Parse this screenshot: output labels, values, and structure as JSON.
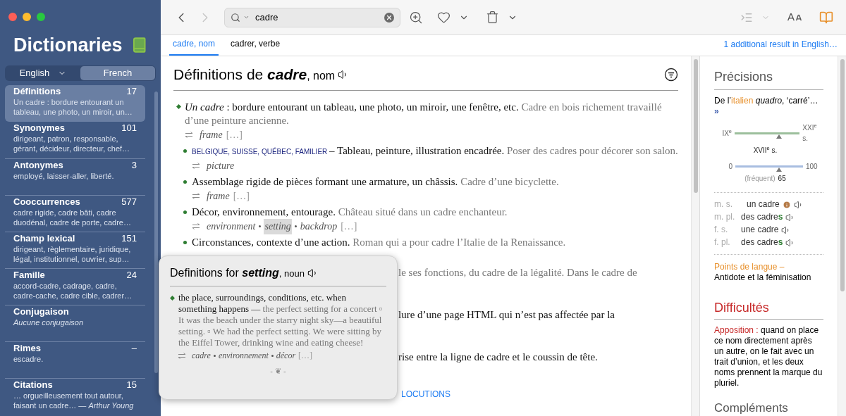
{
  "sidebar": {
    "title": "Dictionaries",
    "languages": [
      {
        "label": "English",
        "selected": false,
        "has_menu": true
      },
      {
        "label": "French",
        "selected": true,
        "has_menu": false
      }
    ],
    "items": [
      {
        "title": "Définitions",
        "count": "17",
        "preview": "Un cadre : bordure entourant un tableau, une photo, un miroir, un…",
        "selected": true
      },
      {
        "title": "Synonymes",
        "count": "101",
        "preview": "dirigeant, patron, responsable, gérant, décideur, directeur, chef…",
        "selected": false
      },
      {
        "title": "Antonymes",
        "count": "3",
        "preview": "employé, laisser-aller, liberté.",
        "selected": false
      },
      {
        "title": "Cooccurrences",
        "count": "577",
        "preview": "cadre rigide, cadre bâti, cadre duodénal, cadre de porte, cadre…",
        "selected": false
      },
      {
        "title": "Champ lexical",
        "count": "151",
        "preview": "dirigeant, règlementaire, juridique, légal, institutionnel, ouvrier, sup…",
        "selected": false
      },
      {
        "title": "Famille",
        "count": "24",
        "preview": "accord-cadre, cadrage, cadre, cadre-cache, cadre cible, cadrer…",
        "selected": false
      },
      {
        "title": "Conjugaison",
        "preview": "*Aucune conjugaison*",
        "selected": false
      },
      {
        "title": "Rimes",
        "count": "–",
        "preview": "escadre.",
        "selected": false
      },
      {
        "title": "Citations",
        "count": "15",
        "preview": "… orgueilleusement tout autour, faisant un cadre… — *Arthur Young*",
        "selected": false
      }
    ]
  },
  "toolbar": {
    "search": {
      "value": "cadre"
    },
    "forward_disabled": true
  },
  "tabs": [
    {
      "label": "cadre, nom",
      "selected": true
    },
    {
      "label": "cadrer, verbe",
      "selected": false
    }
  ],
  "extra_result": "1 additional result in English…",
  "article": {
    "prefix": "Définitions de",
    "word": "cadre",
    "suffix": ", nom",
    "entries": [
      {
        "kind": "main",
        "text": "*Un cadre* : bordure entourant un tableau, une photo, un miroir, une fenêtre, etc.",
        "example": "Cadre en bois richement travaillé d’une peinture ancienne.",
        "translations": [
          {
            "word": "frame",
            "selected": false
          }
        ],
        "more": "[…]"
      },
      {
        "kind": "sub",
        "labels": "BELGIQUE, SUISSE, QUÉBEC, FAMILIER",
        "dash": "–",
        "text": "Tableau, peinture, illustration encadrée.",
        "example": "Poser des cadres pour décorer son salon.",
        "translations": [
          {
            "word": "picture",
            "selected": false
          }
        ]
      },
      {
        "kind": "sub",
        "text": "Assemblage rigide de pièces formant une armature, un châssis.",
        "example": "Cadre d’une bicyclette.",
        "translations": [
          {
            "word": "frame",
            "selected": false
          }
        ],
        "more": "[…]"
      },
      {
        "kind": "sub",
        "text": "Décor, environnement, entourage.",
        "example": "Château situé dans un cadre enchanteur.",
        "translations": [
          {
            "word": "environment",
            "selected": false
          },
          {
            "word": "setting",
            "selected": true
          },
          {
            "word": "backdrop",
            "selected": false
          }
        ],
        "more": "[…]"
      },
      {
        "kind": "sub",
        "text": "Circonstances, contexte d’une action.",
        "example": "Roman qui a pour cadre l’Italie de la Renaissance."
      }
    ],
    "fragments": [
      {
        "kind": "example",
        "text": "le ses fonctions, du cadre de la légalité. Dans le cadre de"
      },
      {
        "kind": "definition",
        "text": "lure d’une page HTML qui n’est pas affectée par la"
      },
      {
        "kind": "definition",
        "text": "rise entre la ligne de cadre et le coussin de tête."
      }
    ],
    "section_link": "LOCUTIONS"
  },
  "popover": {
    "prefix": "Definitions for",
    "word": "setting",
    "suffix": ", noun",
    "definition": "the place, surroundings, conditions, etc. when something happens",
    "dash": "—",
    "example": "the perfect setting for a concert ▫ It was the beach under the starry night sky—a beautiful setting. ▫ We had the perfect setting. We were sitting by the Eiffel Tower, drinking wine and eating cheese!",
    "translations": [
      "cadre",
      "environnement",
      "décor"
    ],
    "more": "[…]",
    "ornament": "- ❦ -"
  },
  "details": {
    "heading": "Précisions",
    "etymology": {
      "before": "De l’",
      "origin": "italien",
      "after": " *quadro*, ‘carré’…",
      "more": "»"
    },
    "epoch": {
      "start": "IX$^{e}$",
      "end": "XXI$^{e}$ s.",
      "value": "XVII$^{e}$ s.",
      "level": 0.68
    },
    "frequency": {
      "start": "0",
      "end": "100",
      "caption": "(fréquent)",
      "value": "65",
      "level": 0.65
    },
    "forms": [
      {
        "label": "m. s.",
        "article": "un",
        "stem": "cadre",
        "info": true
      },
      {
        "label": "m. pl.",
        "article": "des",
        "stem": "cadre",
        "ending": "s",
        "info": false
      },
      {
        "label": "f. s.",
        "article": "une",
        "stem": "cadre",
        "info": false
      },
      {
        "label": "f. pl.",
        "article": "des",
        "stem": "cadre",
        "ending": "s",
        "info": false
      }
    ],
    "note_link": "Points de langue –",
    "note_text": "Antidote et la féminisation",
    "difficulties_heading": "Difficultés",
    "difficulty_term": "Apposition :",
    "difficulty_text": "quand on place ce nom directement après un autre, on le fait avec un trait d’union, et les deux noms prennent la marque du pluriel.",
    "next_heading": "Compléments"
  }
}
